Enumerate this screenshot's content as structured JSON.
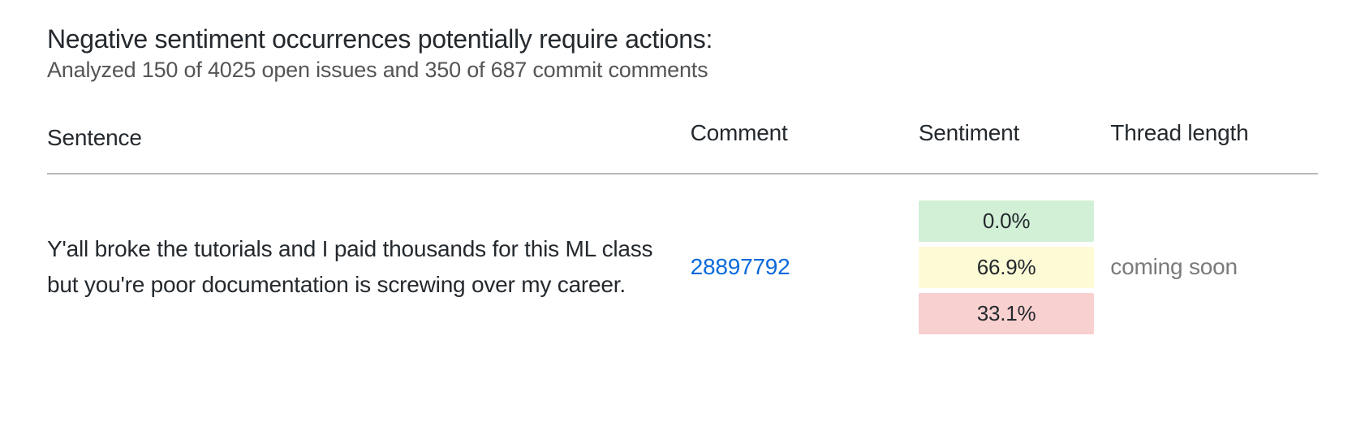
{
  "header": {
    "title": "Negative sentiment occurrences potentially require actions:",
    "subtitle": "Analyzed 150 of 4025 open issues and 350 of 687 commit comments"
  },
  "table": {
    "columns": {
      "sentence": "Sentence",
      "comment": "Comment",
      "sentiment": "Sentiment",
      "thread_length": "Thread length"
    },
    "rows": [
      {
        "sentence": "Y'all broke the tutorials and I paid thousands for this ML class but you're poor documentation is screwing over my career.",
        "comment_id": "28897792",
        "sentiment": {
          "positive": "0.0%",
          "neutral": "66.9%",
          "negative": "33.1%"
        },
        "thread_length": "coming soon"
      }
    ]
  }
}
